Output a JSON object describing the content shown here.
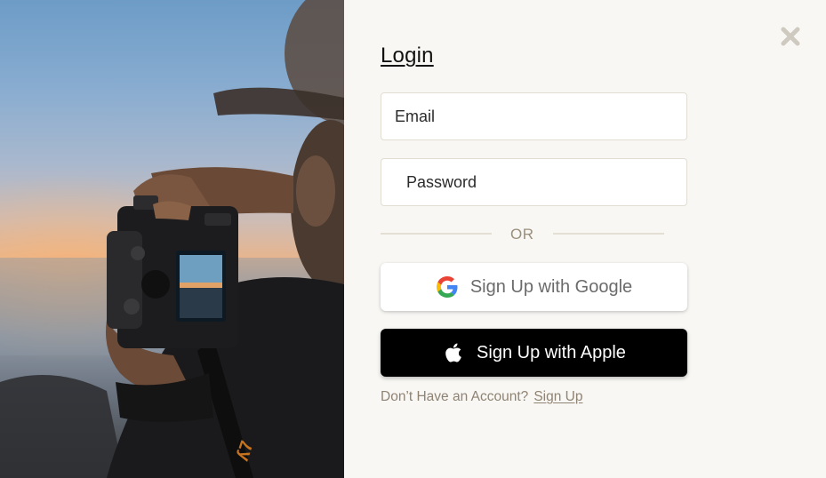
{
  "login": {
    "title": "Login",
    "email_placeholder": "Email",
    "password_placeholder": "Password",
    "divider_text": "OR",
    "google_button_label": "Sign Up with Google",
    "apple_button_label": "Sign Up with Apple",
    "no_account_text": "Don’t Have an Account?",
    "signup_link_label": "Sign Up"
  },
  "icons": {
    "close": "close-icon",
    "google": "google-logo-icon",
    "apple": "apple-logo-icon"
  },
  "colors": {
    "panel_background": "#f8f7f4",
    "apple_button": "#000000",
    "google_button": "#ffffff",
    "muted_text": "#8f8373",
    "field_border": "#e2ddd2"
  }
}
